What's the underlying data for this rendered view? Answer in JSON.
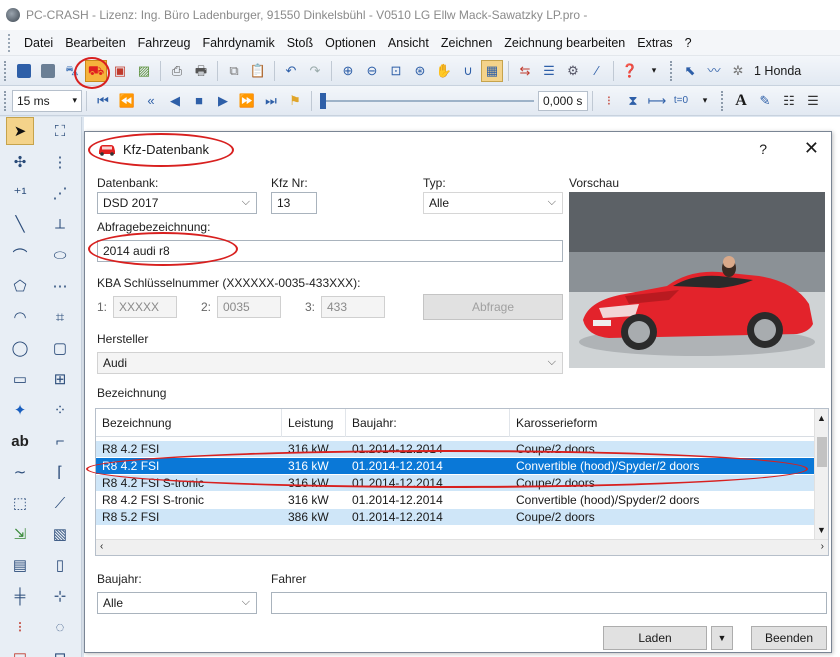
{
  "window": {
    "title": "PC-CRASH - Lizenz: Ing. Büro Ladenburger, 91550 Dinkelsbühl - V0510 LG Ellw Mack-Sawatzky LP.pro -"
  },
  "menu": [
    "Datei",
    "Bearbeiten",
    "Fahrzeug",
    "Fahrdynamik",
    "Stoß",
    "Optionen",
    "Ansicht",
    "Zeichnen",
    "Zeichnung bearbeiten",
    "Extras",
    "?"
  ],
  "toolbar1": {
    "vehicle_name": "1 Honda"
  },
  "toolbar2": {
    "time_step": "15 ms",
    "time_value": "0,000 s"
  },
  "dialog": {
    "title": "Kfz-Datenbank",
    "help": "?",
    "close": "X",
    "datenbank_label": "Datenbank:",
    "datenbank_value": "DSD 2017",
    "kfznr_label": "Kfz Nr:",
    "kfznr_value": "13",
    "typ_label": "Typ:",
    "typ_value": "Alle",
    "vorschau_label": "Vorschau",
    "abfrage_label": "Abfragebezeichnung:",
    "abfrage_value": "2014 audi r8",
    "kba_label": "KBA Schlüsselnummer (XXXXXX-0035-433XXX):",
    "kba1_label": "1:",
    "kba1_value": "XXXXX",
    "kba2_label": "2:",
    "kba2_value": "0035",
    "kba3_label": "3:",
    "kba3_value": "433",
    "abfrage_button": "Abfrage",
    "hersteller_label": "Hersteller",
    "hersteller_value": "Audi",
    "bezeichnung_label": "Bezeichnung",
    "table": {
      "columns": [
        "Bezeichnung",
        "Leistung",
        "Baujahr:",
        "Karosserieform"
      ],
      "rows": [
        [
          "R8 4.2 FSI",
          "316 kW",
          "01.2014-12.2014",
          "Coupe/2 doors"
        ],
        [
          "R8 4.2 FSI",
          "316 kW",
          "01.2014-12.2014",
          "Convertible (hood)/Spyder/2 doors"
        ],
        [
          "R8 4.2 FSI S-tronic",
          "316 kW",
          "01.2014-12.2014",
          "Coupe/2 doors"
        ],
        [
          "R8 4.2 FSI S-tronic",
          "316 kW",
          "01.2014-12.2014",
          "Convertible (hood)/Spyder/2 doors"
        ],
        [
          "R8 5.2 FSI",
          "386 kW",
          "01.2014-12.2014",
          "Coupe/2 doors"
        ]
      ],
      "selected_row": 1
    },
    "baujahr_label": "Baujahr:",
    "baujahr_value": "Alle",
    "fahrer_label": "Fahrer",
    "fahrer_value": "",
    "laden_button": "Laden",
    "beenden_button": "Beenden"
  },
  "colors": {
    "accent": "#0a78d7",
    "annotation": "#d8201f",
    "car": "#e02020"
  }
}
